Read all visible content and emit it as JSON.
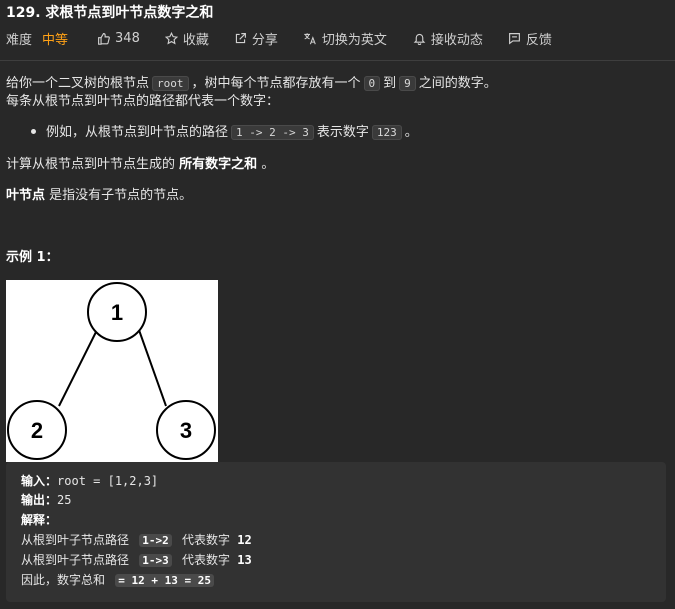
{
  "title": "129. 求根节点到叶节点数字之和",
  "meta": {
    "difficulty_label": "难度",
    "difficulty_value": "中等",
    "likes": "348",
    "favorite_label": "收藏",
    "share_label": "分享",
    "translate_label": "切换为英文",
    "notify_label": "接收动态",
    "feedback_label": "反馈",
    "difficulty_color": "#ffa116"
  },
  "description": {
    "p1_a": "给你一个二叉树的根节点",
    "p1_code1": "root",
    "p1_b": "，树中每个节点都存放有一个",
    "p1_code2": "0",
    "p1_c": "到",
    "p1_code3": "9",
    "p1_d": "之间的数字。",
    "p2": "每条从根节点到叶节点的路径都代表一个数字：",
    "bullet_a": "例如，从根节点到叶节点的路径",
    "bullet_code1": "1 -> 2 -> 3",
    "bullet_b": "表示数字",
    "bullet_code2": "123",
    "bullet_c": "。",
    "p3_a": "计算从根节点到叶节点生成的",
    "p3_bold": "所有数字之和",
    "p3_b": "。",
    "p4_bold": "叶节点",
    "p4_b": "是指没有子节点的节点。"
  },
  "example": {
    "heading": "示例 1：",
    "tree_nodes": [
      "1",
      "2",
      "3"
    ],
    "input_label": "输入：",
    "input_value": "root = [1,2,3]",
    "output_label": "输出：",
    "output_value": "25",
    "explain_label": "解释：",
    "line1_a": "从根到叶子节点路径",
    "line1_code": "1->2",
    "line1_b": "代表数字",
    "line1_num": "12",
    "line2_a": "从根到叶子节点路径",
    "line2_code": "1->3",
    "line2_b": "代表数字",
    "line2_num": "13",
    "line3_a": "因此，数字总和",
    "line3_code": "= 12 + 13 = 25"
  }
}
